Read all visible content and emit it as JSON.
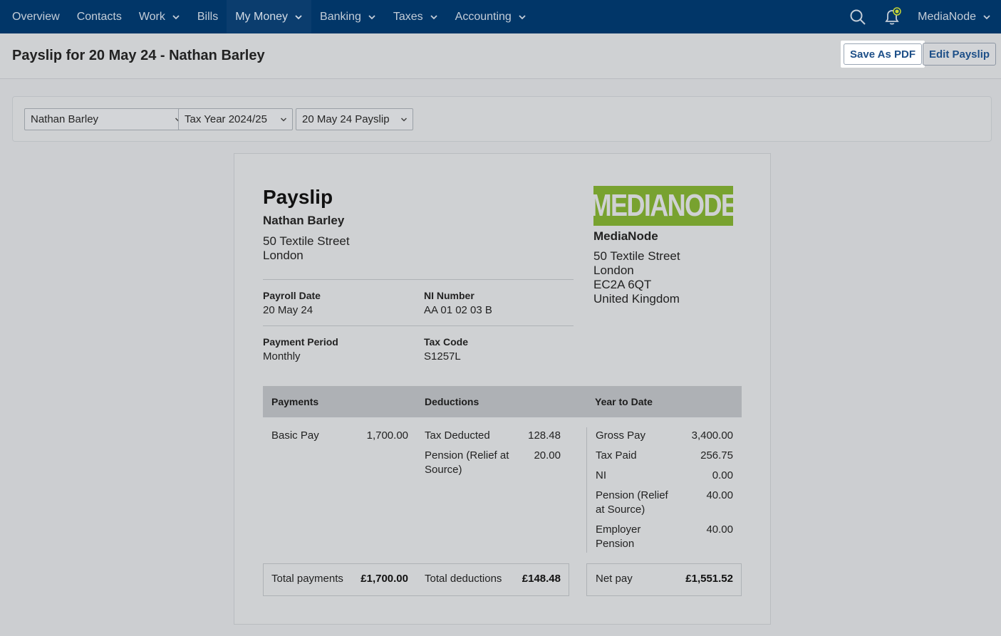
{
  "nav": {
    "items": [
      {
        "label": "Overview",
        "has_menu": false
      },
      {
        "label": "Contacts",
        "has_menu": false
      },
      {
        "label": "Work",
        "has_menu": true
      },
      {
        "label": "Bills",
        "has_menu": false
      },
      {
        "label": "My Money",
        "has_menu": true,
        "active": true
      },
      {
        "label": "Banking",
        "has_menu": true
      },
      {
        "label": "Taxes",
        "has_menu": true
      },
      {
        "label": "Accounting",
        "has_menu": true
      }
    ],
    "account_name": "MediaNode",
    "icons": [
      "search-icon",
      "notification-bell-icon"
    ],
    "bar_color": "#013668",
    "notification_dot_color": "#c7d633"
  },
  "header": {
    "title": "Payslip for 20 May 24 - Nathan Barley",
    "save_pdf_label": "Save As PDF",
    "edit_label": "Edit Payslip"
  },
  "filters": {
    "employee": "Nathan Barley",
    "tax_year": "Tax Year 2024/25",
    "payslip": "20 May 24 Payslip"
  },
  "payslip": {
    "title": "Payslip",
    "employee": {
      "name": "Nathan Barley",
      "address": [
        "50 Textile Street",
        "London"
      ]
    },
    "company": {
      "logo_text": "MEDIANODE",
      "logo_color": "#78a22f",
      "name": "MediaNode",
      "address": [
        "50 Textile Street",
        "London",
        "EC2A 6QT",
        "United Kingdom"
      ]
    },
    "meta": {
      "payroll_date_label": "Payroll Date",
      "payroll_date": "20 May 24",
      "ni_number_label": "NI Number",
      "ni_number": "AA 01 02 03 B",
      "payment_period_label": "Payment Period",
      "payment_period": "Monthly",
      "tax_code_label": "Tax Code",
      "tax_code": "S1257L"
    },
    "table": {
      "headers": {
        "payments": "Payments",
        "deductions": "Deductions",
        "ytd": "Year to Date"
      },
      "payments": [
        {
          "label": "Basic Pay",
          "amount": "1,700.00"
        }
      ],
      "deductions": [
        {
          "label": "Tax Deducted",
          "amount": "128.48"
        },
        {
          "label": "Pension (Relief at Source)",
          "amount": "20.00"
        }
      ],
      "ytd": [
        {
          "label": "Gross Pay",
          "amount": "3,400.00"
        },
        {
          "label": "Tax Paid",
          "amount": "256.75"
        },
        {
          "label": "NI",
          "amount": "0.00"
        },
        {
          "label": "Pension (Relief at Source)",
          "amount": "40.00"
        },
        {
          "label": "Employer Pension",
          "amount": "40.00"
        }
      ]
    },
    "totals": {
      "payments_label": "Total payments",
      "payments": "£1,700.00",
      "deductions_label": "Total deductions",
      "deductions": "£148.48",
      "net_label": "Net pay",
      "net": "£1,551.52"
    }
  }
}
